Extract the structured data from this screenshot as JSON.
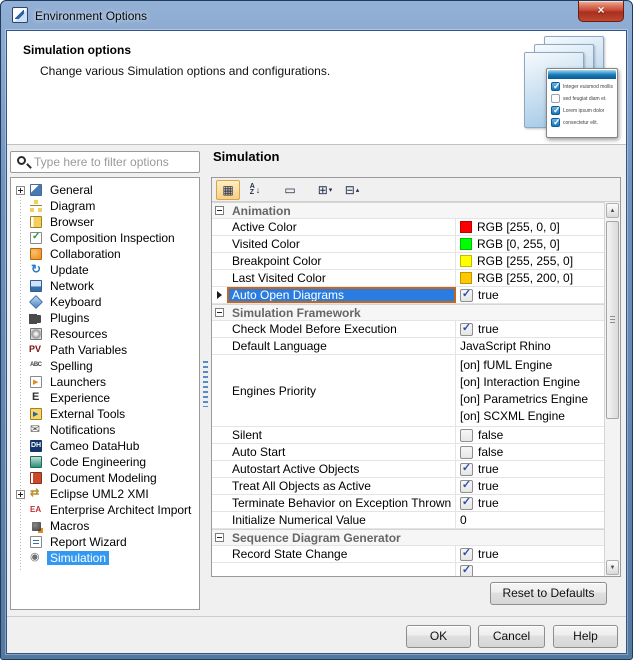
{
  "window": {
    "title": "Environment Options"
  },
  "header": {
    "title": "Simulation options",
    "description": "Change various Simulation options and configurations.",
    "graphic": {
      "items": [
        {
          "checked": true,
          "label": "Integer euismod mollis"
        },
        {
          "checked": false,
          "label": "sed feugiat diam et."
        },
        {
          "checked": true,
          "label": "Lorem ipsum dolor"
        },
        {
          "checked": true,
          "label": "consectetur elit."
        }
      ]
    }
  },
  "sidebar": {
    "filter_placeholder": "Type here to filter options",
    "tree": [
      {
        "label": "General",
        "icon": "general-icon",
        "expandable": true
      },
      {
        "label": "Diagram",
        "icon": "diagram-icon"
      },
      {
        "label": "Browser",
        "icon": "browser-icon"
      },
      {
        "label": "Composition Inspection",
        "icon": "composition-inspection-icon"
      },
      {
        "label": "Collaboration",
        "icon": "collaboration-icon"
      },
      {
        "label": "Update",
        "icon": "update-icon"
      },
      {
        "label": "Network",
        "icon": "network-icon"
      },
      {
        "label": "Keyboard",
        "icon": "keyboard-icon"
      },
      {
        "label": "Plugins",
        "icon": "plugins-icon"
      },
      {
        "label": "Resources",
        "icon": "resources-icon"
      },
      {
        "label": "Path Variables",
        "icon": "path-variables-icon"
      },
      {
        "label": "Spelling",
        "icon": "spelling-icon"
      },
      {
        "label": "Launchers",
        "icon": "launchers-icon"
      },
      {
        "label": "Experience",
        "icon": "experience-icon"
      },
      {
        "label": "External Tools",
        "icon": "external-tools-icon"
      },
      {
        "label": "Notifications",
        "icon": "notifications-icon"
      },
      {
        "label": "Cameo DataHub",
        "icon": "cameo-datahub-icon"
      },
      {
        "label": "Code Engineering",
        "icon": "code-engineering-icon"
      },
      {
        "label": "Document Modeling",
        "icon": "document-modeling-icon"
      },
      {
        "label": "Eclipse UML2 XMI",
        "icon": "eclipse-uml2-xmi-icon",
        "expandable": true
      },
      {
        "label": "Enterprise Architect Import",
        "icon": "enterprise-architect-import-icon"
      },
      {
        "label": "Macros",
        "icon": "macros-icon"
      },
      {
        "label": "Report Wizard",
        "icon": "report-wizard-icon"
      },
      {
        "label": "Simulation",
        "icon": "simulation-icon",
        "selected": true
      }
    ]
  },
  "panel": {
    "title": "Simulation",
    "toolbar": [
      {
        "icon": "categorized-view-icon",
        "active": true
      },
      {
        "icon": "sort-alphabetically-icon",
        "active": false
      },
      {
        "icon": "show-description-icon",
        "active": false
      },
      {
        "icon": "expand-all-icon",
        "active": false
      },
      {
        "icon": "collapse-all-icon",
        "active": false
      }
    ],
    "rows": [
      {
        "kind": "group",
        "name": "Animation"
      },
      {
        "kind": "color",
        "name": "Active Color",
        "value": "RGB [255, 0, 0]",
        "color": "#ff0000"
      },
      {
        "kind": "color",
        "name": "Visited Color",
        "value": "RGB [0, 255, 0]",
        "color": "#00ff00"
      },
      {
        "kind": "color",
        "name": "Breakpoint Color",
        "value": "RGB [255, 255, 0]",
        "color": "#ffff00"
      },
      {
        "kind": "color",
        "name": "Last Visited Color",
        "value": "RGB [255, 200, 0]",
        "color": "#ffc800"
      },
      {
        "kind": "bool",
        "name": "Auto Open Diagrams",
        "value": "true",
        "checked": true,
        "selected": true
      },
      {
        "kind": "group",
        "name": "Simulation Framework"
      },
      {
        "kind": "bool",
        "name": "Check Model Before Execution",
        "value": "true",
        "checked": true
      },
      {
        "kind": "text",
        "name": "Default Language",
        "value": "JavaScript Rhino"
      },
      {
        "kind": "list",
        "name": "Engines Priority",
        "lines": [
          "[on] fUML Engine",
          "[on] Interaction Engine",
          "[on] Parametrics Engine",
          "[on] SCXML Engine"
        ]
      },
      {
        "kind": "bool",
        "name": "Silent",
        "value": "false",
        "checked": false
      },
      {
        "kind": "bool",
        "name": "Auto Start",
        "value": "false",
        "checked": false
      },
      {
        "kind": "bool",
        "name": "Autostart Active Objects",
        "value": "true",
        "checked": true
      },
      {
        "kind": "bool",
        "name": "Treat All Objects as Active",
        "value": "true",
        "checked": true
      },
      {
        "kind": "bool",
        "name": "Terminate Behavior on Exception Thrown",
        "value": "true",
        "checked": true
      },
      {
        "kind": "text",
        "name": "Initialize Numerical Value",
        "value": "0"
      },
      {
        "kind": "group",
        "name": "Sequence Diagram Generator"
      },
      {
        "kind": "bool",
        "name": "Record State Change",
        "value": "true",
        "checked": true
      }
    ],
    "reset_label": "Reset to Defaults"
  },
  "footer": {
    "ok": "OK",
    "cancel": "Cancel",
    "help": "Help"
  },
  "theme": {
    "selection_blue": "#2a7ce0",
    "selection_border": "#c06820",
    "tree_selection_blue": "#3399f0",
    "titlebar_blue": "#6e92bd"
  }
}
